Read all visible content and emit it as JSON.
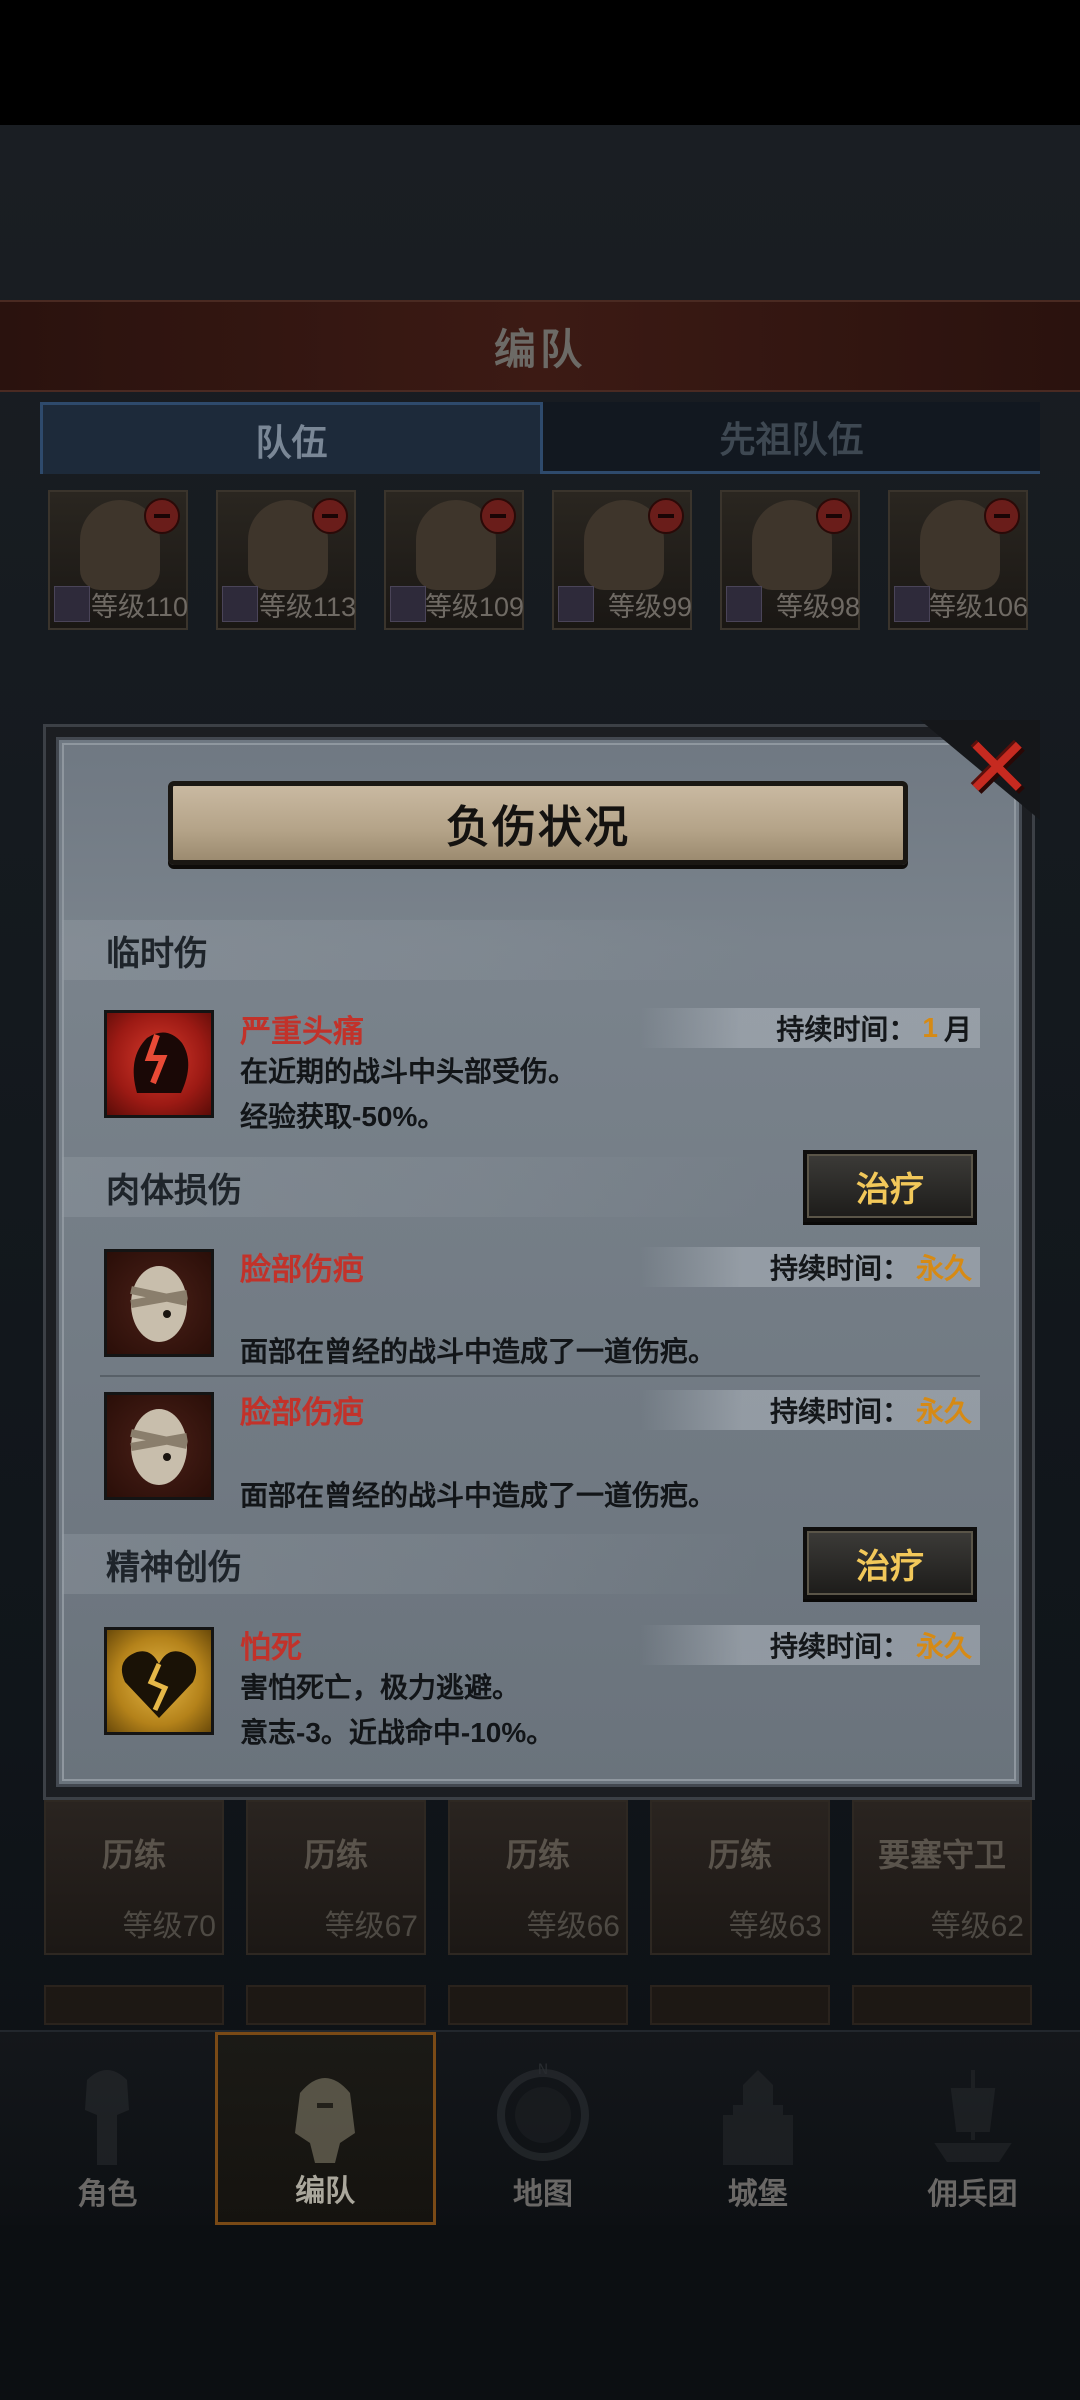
{
  "background": {
    "title": "编队",
    "tabs": [
      "队伍",
      "先祖队伍"
    ],
    "heroes": [
      {
        "level_label": "等级110"
      },
      {
        "level_label": "等级113"
      },
      {
        "level_label": "等级109"
      },
      {
        "level_label": "等级99"
      },
      {
        "level_label": "等级98"
      },
      {
        "level_label": "等级106"
      }
    ],
    "roster": [
      {
        "label": "历练",
        "level": "等级70"
      },
      {
        "label": "历练",
        "level": "等级67"
      },
      {
        "label": "历练",
        "level": "等级66"
      },
      {
        "label": "历练",
        "level": "等级63"
      },
      {
        "label": "要塞守卫",
        "level": "等级62"
      }
    ]
  },
  "nav": {
    "items": [
      {
        "label": "角色",
        "icon": "knight-icon"
      },
      {
        "label": "编队",
        "icon": "helmet-icon",
        "active": true
      },
      {
        "label": "地图",
        "icon": "compass-map-icon"
      },
      {
        "label": "城堡",
        "icon": "castle-icon"
      },
      {
        "label": "佣兵团",
        "icon": "mercenary-ship-icon"
      }
    ]
  },
  "modal": {
    "title": "负伤状况",
    "close_icon": "close-x-icon",
    "sections": {
      "temporary": {
        "label": "临时伤",
        "items": [
          {
            "name": "严重头痛",
            "desc1": "在近期的战斗中头部受伤。",
            "desc2": "经验获取-50%。",
            "duration_label": "持续时间：",
            "duration_value": "1",
            "duration_unit": "月",
            "icon": "headache-icon"
          }
        ]
      },
      "physical": {
        "label": "肉体损伤",
        "treat_label": "治疗",
        "items": [
          {
            "name": "脸部伤疤",
            "desc": "面部在曾经的战斗中造成了一道伤疤。",
            "duration_label": "持续时间：",
            "duration_value": "永久",
            "icon": "bandaged-face-icon"
          },
          {
            "name": "脸部伤疤",
            "desc": "面部在曾经的战斗中造成了一道伤疤。",
            "duration_label": "持续时间：",
            "duration_value": "永久",
            "icon": "bandaged-face-icon"
          }
        ]
      },
      "mental": {
        "label": "精神创伤",
        "treat_label": "治疗",
        "items": [
          {
            "name": "怕死",
            "desc1": "害怕死亡，极力逃避。",
            "desc2": "意志-3。近战命中-10%。",
            "duration_label": "持续时间：",
            "duration_value": "永久",
            "icon": "broken-heart-icon"
          }
        ]
      }
    }
  },
  "colors": {
    "accent_gold": "#f2c85a",
    "injury_red": "#c2322a",
    "duration_orange": "#d68a14",
    "close_red": "#c62a20"
  }
}
